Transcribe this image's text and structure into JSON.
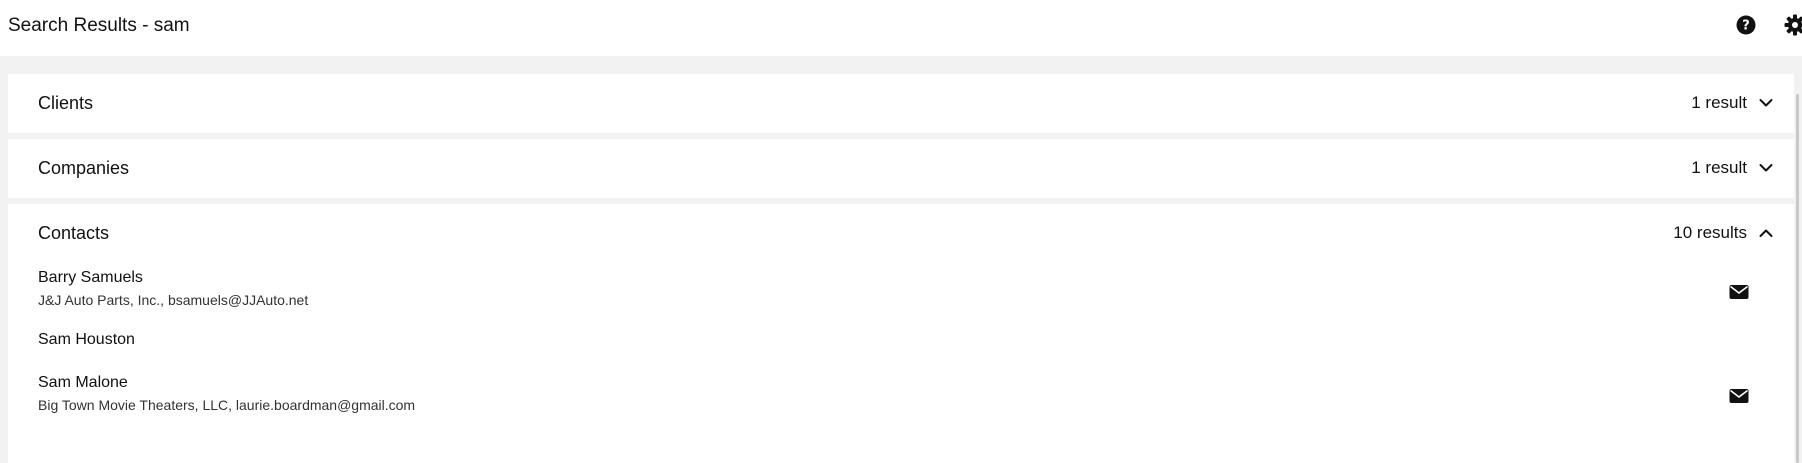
{
  "header": {
    "title": "Search Results - sam",
    "icons": [
      "help-icon",
      "gear-icon"
    ]
  },
  "sections": [
    {
      "title": "Clients",
      "count": "1 result",
      "expanded": false
    },
    {
      "title": "Companies",
      "count": "1 result",
      "expanded": false
    },
    {
      "title": "Contacts",
      "count": "10 results",
      "expanded": true
    }
  ],
  "contacts": [
    {
      "name": "Barry Samuels",
      "detail": "J&J Auto Parts, Inc., bsamuels@JJAuto.net",
      "has_email": true
    },
    {
      "name": "Sam Houston",
      "detail": "",
      "has_email": false
    },
    {
      "name": "Sam Malone",
      "detail": "Big Town Movie Theaters, LLC, laurie.boardman@gmail.com",
      "has_email": true
    }
  ]
}
